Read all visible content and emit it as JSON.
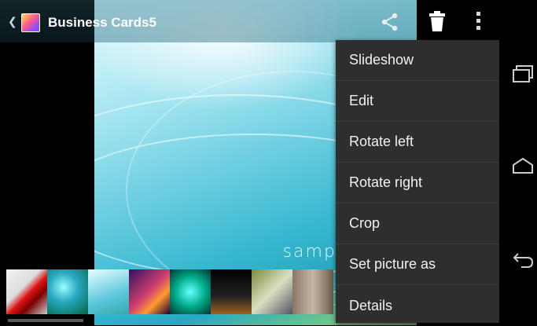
{
  "action_bar": {
    "title": "Business Cards5",
    "back_icon": "chevron-left-icon",
    "app_icon": "gallery-app-icon",
    "share_icon": "share-icon",
    "delete_icon": "trash-icon",
    "overflow_icon": "overflow-menu-icon"
  },
  "photo": {
    "overlay_text": "sample text"
  },
  "menu": {
    "items": [
      {
        "label": "Slideshow"
      },
      {
        "label": "Edit"
      },
      {
        "label": "Rotate left"
      },
      {
        "label": "Rotate right"
      },
      {
        "label": "Crop"
      },
      {
        "label": "Set picture as"
      },
      {
        "label": "Details"
      }
    ]
  },
  "navbar": {
    "recents_icon": "recent-apps-icon",
    "home_icon": "home-icon",
    "back_icon": "back-arrow-icon"
  },
  "colors": {
    "menu_bg": "#2e2e2e",
    "menu_divider": "#3f3f3f"
  }
}
